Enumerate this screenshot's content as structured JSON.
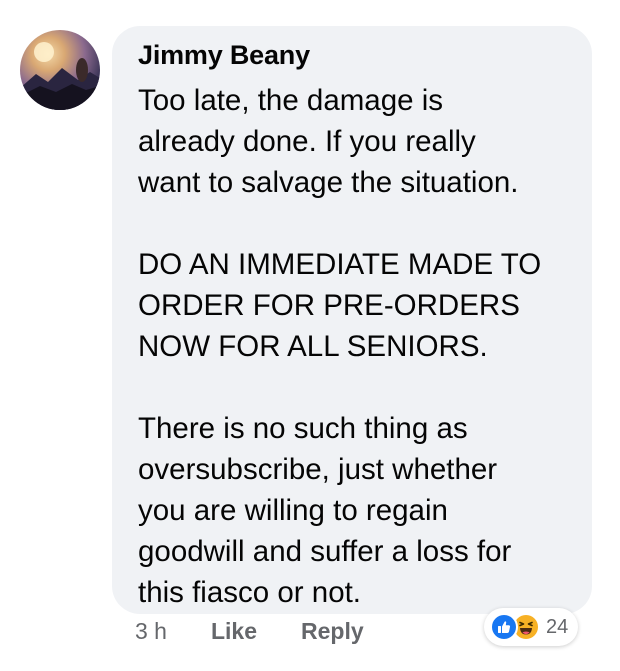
{
  "comment": {
    "author": "Jimmy Beany",
    "paragraphs": [
      [
        "Too late, the damage is",
        "already done. If you really",
        "want to salvage the situation."
      ],
      [
        "DO AN IMMEDIATE MADE TO",
        "ORDER FOR PRE-ORDERS",
        "NOW FOR ALL SENIORS."
      ],
      [
        "There is no such thing as",
        "oversubscribe, just whether",
        "you are willing to regain",
        "goodwill and suffer a loss for",
        "this fiasco or not."
      ]
    ]
  },
  "actions": {
    "time": "3 h",
    "like_label": "Like",
    "reply_label": "Reply"
  },
  "reactions": {
    "icons": [
      "like-icon",
      "haha-icon"
    ],
    "count": "24",
    "colors": {
      "like": "#1877f2",
      "haha": "#f7b125"
    }
  },
  "colors": {
    "bubble": "#f0f2f5",
    "text": "#050505",
    "secondary": "#65676b"
  }
}
